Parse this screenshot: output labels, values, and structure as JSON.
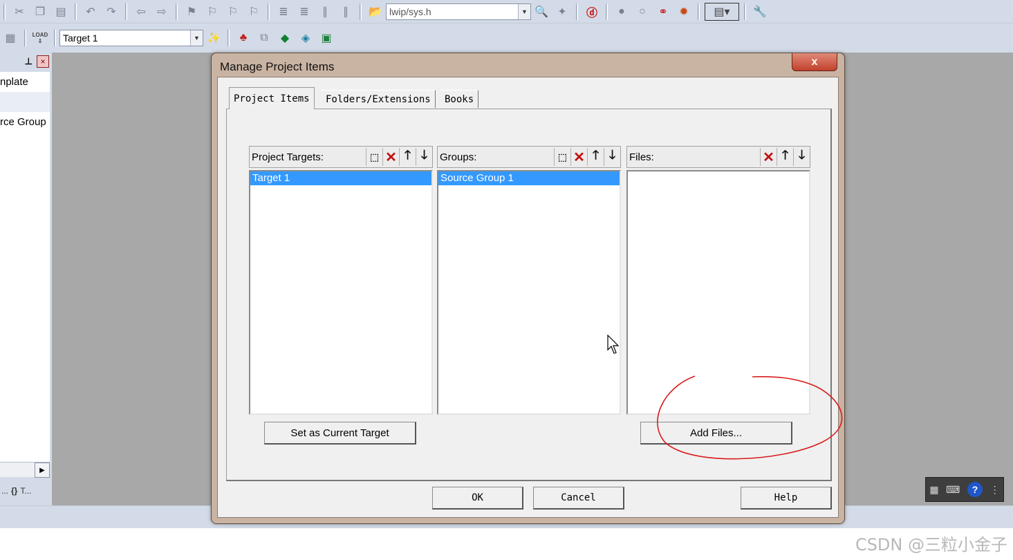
{
  "toolbar1": {
    "file_combo_value": "lwip/sys.h"
  },
  "toolbar2": {
    "load_label": "LOAD",
    "target_combo_value": "Target 1"
  },
  "left_panel": {
    "tree_items": [
      "nplate",
      "",
      "rce Group"
    ],
    "bottom_tabs": [
      "...",
      "T..."
    ]
  },
  "dialog": {
    "title": "Manage Project Items",
    "close_label": "x",
    "tabs": [
      "Project Items",
      "Folders/Extensions",
      "Books"
    ],
    "active_tab": "Project Items",
    "targets": {
      "label": "Project Targets:",
      "items": [
        "Target 1"
      ],
      "selected": "Target 1"
    },
    "groups": {
      "label": "Groups:",
      "items": [
        "Source Group 1"
      ],
      "selected": "Source Group 1"
    },
    "files": {
      "label": "Files:",
      "items": []
    },
    "set_current_target_label": "Set as Current Target",
    "add_files_label": "Add Files...",
    "ok_label": "OK",
    "cancel_label": "Cancel",
    "help_label": "Help"
  },
  "watermark": "CSDN @三粒小金子",
  "colors": {
    "selection": "#3399ff",
    "annotation": "#d81b1b",
    "toolbar_bg": "#d4dbe8",
    "workspace_bg": "#a8a8a8"
  }
}
